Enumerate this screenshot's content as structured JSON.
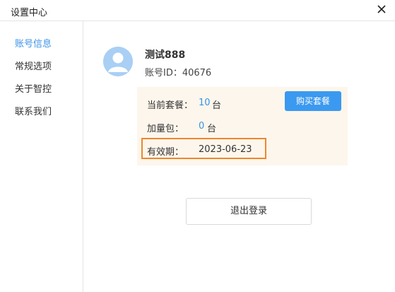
{
  "window": {
    "title": "设置中心",
    "close_icon": "close-icon"
  },
  "sidebar": {
    "items": [
      {
        "label": "账号信息",
        "active": true
      },
      {
        "label": "常规选项",
        "active": false
      },
      {
        "label": "关于智控",
        "active": false
      },
      {
        "label": "联系我们",
        "active": false
      }
    ]
  },
  "account": {
    "avatar_icon": "user-avatar-icon",
    "username": "测试888",
    "id_label": "账号ID：",
    "id_value": "40676",
    "id_text": "账号ID：40676"
  },
  "plan": {
    "current_label": "当前套餐：",
    "current_value": "10",
    "current_unit": "台",
    "addon_label": "加量包：",
    "addon_value": "0",
    "addon_unit": "台",
    "validity_label": "有效期：",
    "validity_value": "2023-06-23",
    "buy_button": "购买套餐"
  },
  "actions": {
    "logout_button": "退出登录"
  },
  "colors": {
    "accent": "#3b93e8",
    "button_blue": "#3b99f0",
    "card_bg": "#fdf6ec",
    "highlight": "#f0862c",
    "avatar": "#a9cff4"
  }
}
